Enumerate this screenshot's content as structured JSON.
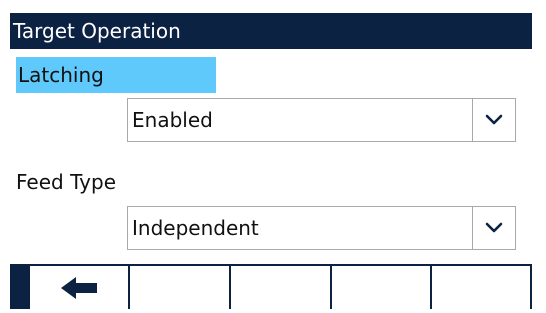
{
  "header": {
    "title": "Target Operation"
  },
  "fields": [
    {
      "label": "Latching",
      "value": "Enabled",
      "selected": true
    },
    {
      "label": "Feed Type",
      "value": "Independent",
      "selected": false
    }
  ],
  "softkeys": [
    {
      "icon": "back-arrow-icon"
    },
    {
      "icon": ""
    },
    {
      "icon": ""
    },
    {
      "icon": ""
    },
    {
      "icon": ""
    }
  ],
  "colors": {
    "header_bg": "#0c2243",
    "selection_highlight": "#5fc9fb",
    "chevron": "#0c2243"
  }
}
